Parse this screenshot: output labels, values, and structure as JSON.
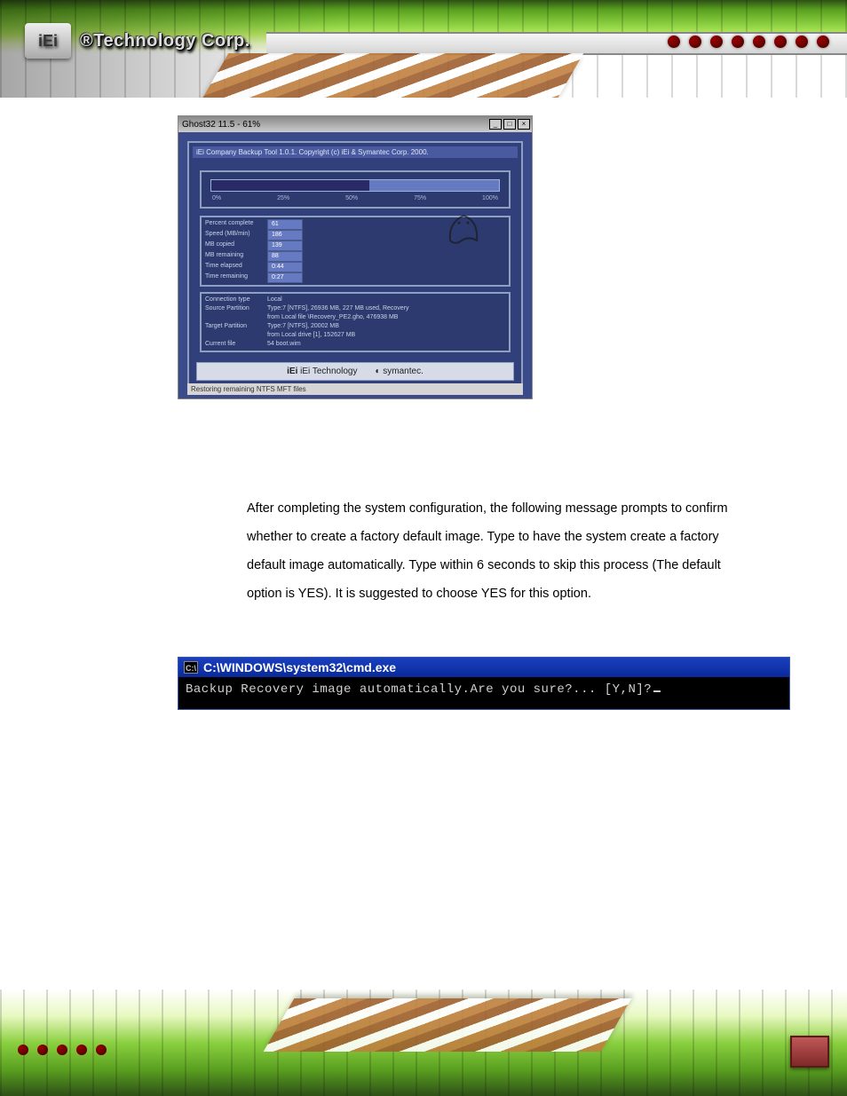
{
  "header": {
    "logo_text": "®Technology Corp.",
    "logo_mark": "iEi"
  },
  "ghost": {
    "title": "Ghost32 11.5 - 61%",
    "banner": "iEi Company Backup Tool 1.0.1.  Copyright (c) iEi & Symantec Corp. 2000.",
    "progress_ticks": [
      "0%",
      "25%",
      "50%",
      "75%",
      "100%"
    ],
    "stats": [
      {
        "k": "Percent complete",
        "v": "61"
      },
      {
        "k": "Speed (MB/min)",
        "v": "186"
      },
      {
        "k": "MB copied",
        "v": "139"
      },
      {
        "k": "MB remaining",
        "v": "88"
      },
      {
        "k": "Time elapsed",
        "v": "0:44"
      },
      {
        "k": "Time remaining",
        "v": "0:27"
      }
    ],
    "details": [
      {
        "k": "Connection type",
        "v": "Local"
      },
      {
        "k": "Source Partition",
        "v": "Type:7 [NTFS], 26936 MB, 227 MB used, Recovery"
      },
      {
        "k": "",
        "v": "from Local file \\Recovery_PE2.gho, 476938 MB"
      },
      {
        "k": "Target Partition",
        "v": "Type:7 [NTFS], 20002 MB"
      },
      {
        "k": "",
        "v": "from Local drive [1], 152627 MB"
      },
      {
        "k": "Current file",
        "v": "54 boot.wim"
      }
    ],
    "logo1": "iEi Technology",
    "logo2": "symantec.",
    "statusbar": "Restoring remaining NTFS MFT files"
  },
  "body_paragraph": "After completing the system configuration, the following message prompts to confirm whether to create a factory default image. Type     to have the system create a factory default image automatically. Type     within 6 seconds to skip this process (The default option is YES). It is suggested to choose YES for this option.",
  "cmd": {
    "title": "C:\\WINDOWS\\system32\\cmd.exe",
    "icon": "C:\\",
    "line": "Backup Recovery image automatically.Are you sure?... [Y,N]?"
  }
}
